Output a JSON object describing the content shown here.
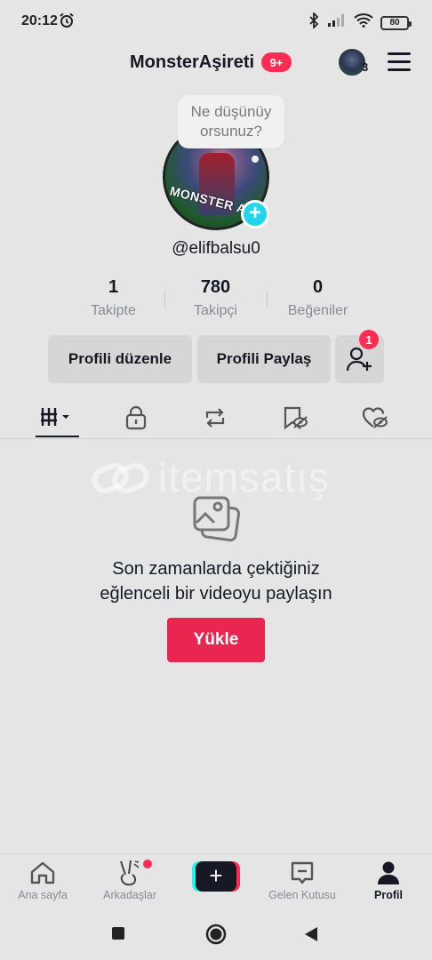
{
  "status_bar": {
    "time": "20:12",
    "battery": "80",
    "icons": [
      "alarm-icon",
      "bluetooth-icon",
      "signal-icon",
      "wifi-icon",
      "battery-icon"
    ]
  },
  "header": {
    "title": "MonsterAşireti",
    "notification_badge": "9+",
    "account_count": "3",
    "icons": [
      "account-switch-avatar",
      "menu-icon"
    ]
  },
  "profile": {
    "bubble_text": "Ne düşünüy orsunuz?",
    "bubble_line1": "Ne düşünüy",
    "bubble_line2": "orsunuz?",
    "avatar_overlay_text": "MONSTER AŞ",
    "handle": "@elifbalsu0"
  },
  "stats": [
    {
      "value": "1",
      "label": "Takipte"
    },
    {
      "value": "780",
      "label": "Takipçi"
    },
    {
      "value": "0",
      "label": "Beğeniler"
    }
  ],
  "actions": {
    "edit_label": "Profili düzenle",
    "share_label": "Profili Paylaş",
    "friend_badge": "1"
  },
  "tabs": [
    "videos-grid-icon",
    "lock-icon",
    "repost-icon",
    "favorites-icon",
    "liked-icon"
  ],
  "watermark": "itemsatış",
  "empty_state": {
    "line1": "Son zamanlarda çektiğiniz",
    "line2": "eğlenceli bir videoyu paylaşın",
    "upload_label": "Yükle"
  },
  "bottom_nav": {
    "home": "Ana sayfa",
    "friends": "Arkadaşlar",
    "create": "+",
    "inbox": "Gelen Kutusu",
    "profile": "Profil"
  },
  "colors": {
    "accent": "#fe2c55",
    "cyan": "#25f4ee",
    "background": "#e5e5e5",
    "text": "#161823",
    "muted": "#8a8b91"
  }
}
